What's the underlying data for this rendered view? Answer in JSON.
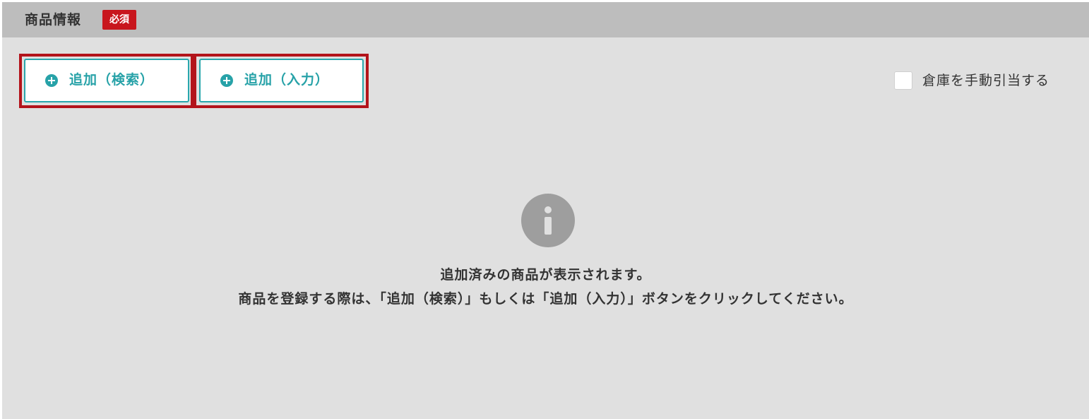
{
  "section": {
    "title": "商品情報",
    "required_badge": "必須"
  },
  "toolbar": {
    "add_search_label": "追加（検索）",
    "add_input_label": "追加（入力）",
    "manual_allocate_label": "倉庫を手動引当する",
    "manual_allocate_checked": false
  },
  "empty_state": {
    "icon": "info-icon",
    "line1": "追加済みの商品が表示されます。",
    "line2": "商品を登録する際は、「追加（検索）」もしくは「追加（入力）」ボタンをクリックしてください。"
  },
  "colors": {
    "accent": "#27a2a8",
    "required": "#c8161d",
    "highlight": "#b3141b",
    "header_bg": "#bdbdbd",
    "panel_bg": "#e0e0e0"
  }
}
